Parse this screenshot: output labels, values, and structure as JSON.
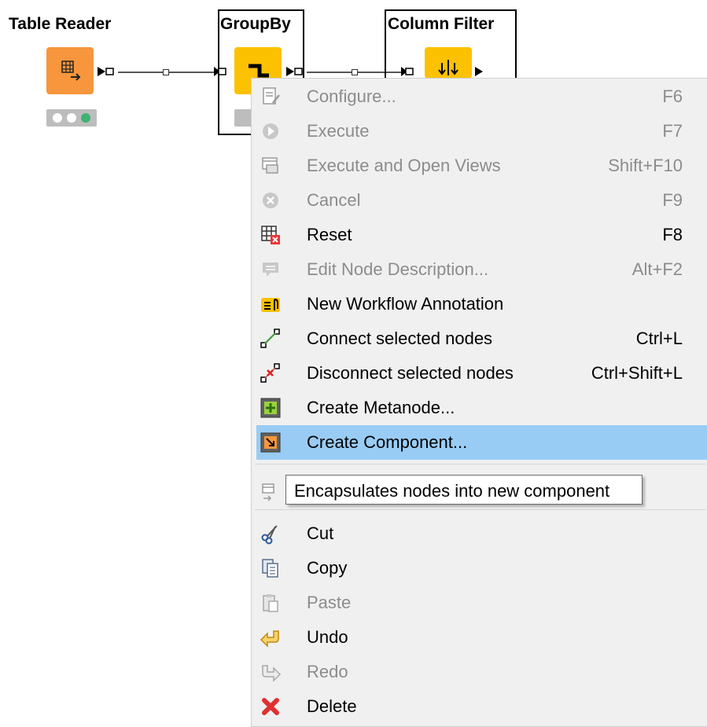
{
  "nodes": [
    {
      "title": "Table Reader"
    },
    {
      "title": "GroupBy"
    },
    {
      "title": "Column Filter"
    }
  ],
  "menu": {
    "items": [
      {
        "label": "Configure...",
        "shortcut": "F6"
      },
      {
        "label": "Execute",
        "shortcut": "F7"
      },
      {
        "label": "Execute and Open Views",
        "shortcut": "Shift+F10"
      },
      {
        "label": "Cancel",
        "shortcut": "F9"
      },
      {
        "label": "Reset",
        "shortcut": "F8"
      },
      {
        "label": "Edit Node Description...",
        "shortcut": "Alt+F2"
      },
      {
        "label": "New Workflow Annotation",
        "shortcut": ""
      },
      {
        "label": "Connect selected nodes",
        "shortcut": "Ctrl+L"
      },
      {
        "label": "Disconnect selected nodes",
        "shortcut": "Ctrl+Shift+L"
      },
      {
        "label": "Create Metanode...",
        "shortcut": ""
      },
      {
        "label": "Create Component...",
        "shortcut": ""
      },
      {
        "label": "Cut",
        "shortcut": ""
      },
      {
        "label": "Copy",
        "shortcut": ""
      },
      {
        "label": "Paste",
        "shortcut": ""
      },
      {
        "label": "Undo",
        "shortcut": ""
      },
      {
        "label": "Redo",
        "shortcut": ""
      },
      {
        "label": "Delete",
        "shortcut": ""
      }
    ]
  },
  "tooltip": {
    "text": "Encapsulates nodes into new component"
  },
  "colors": {
    "highlight": "#99ccf5",
    "menu_bg": "#f0f0f0",
    "disabled_text": "#8c8c8c",
    "node_orange": "#f7963c",
    "node_yellow": "#fcc100",
    "status_green": "#3cb371"
  }
}
